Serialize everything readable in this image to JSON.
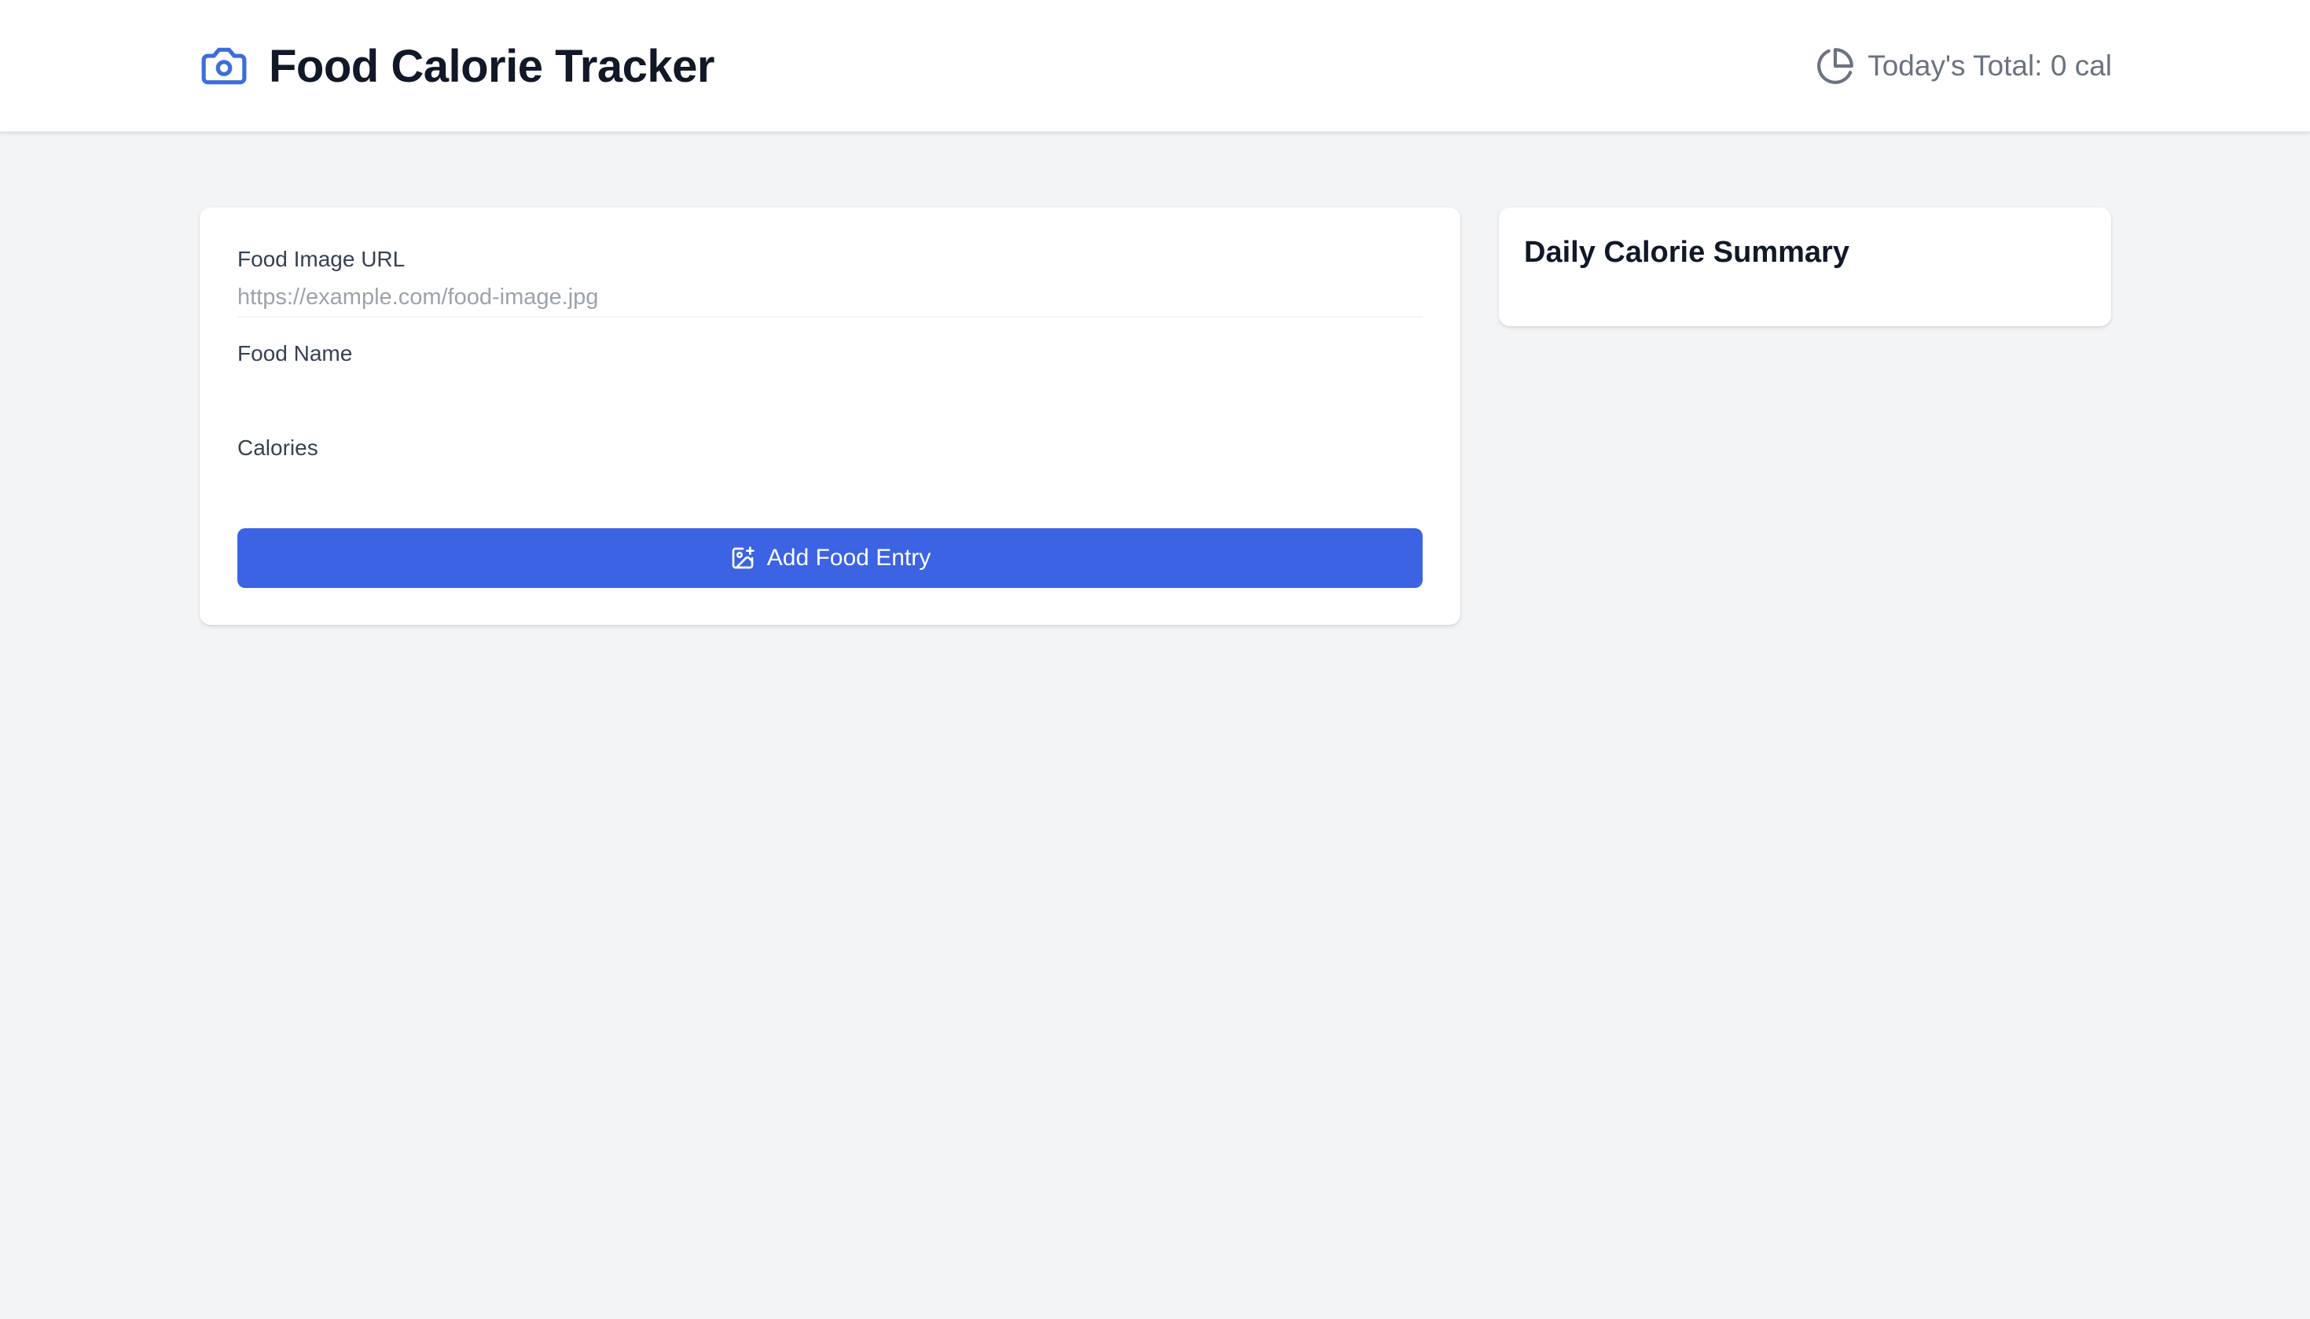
{
  "header": {
    "title": "Food Calorie Tracker",
    "brand_icon": "camera-icon",
    "total_icon": "pie-chart-icon",
    "total_text": "Today's Total: 0 cal",
    "brand_color": "#3b6fd9"
  },
  "form": {
    "image_url": {
      "label": "Food Image URL",
      "placeholder": "https://example.com/food-image.jpg",
      "value": ""
    },
    "food_name": {
      "label": "Food Name",
      "value": ""
    },
    "calories": {
      "label": "Calories",
      "value": ""
    },
    "submit": {
      "label": "Add Food Entry",
      "icon": "image-plus-icon",
      "color": "#3b63e4"
    }
  },
  "summary": {
    "title": "Daily Calorie Summary"
  }
}
